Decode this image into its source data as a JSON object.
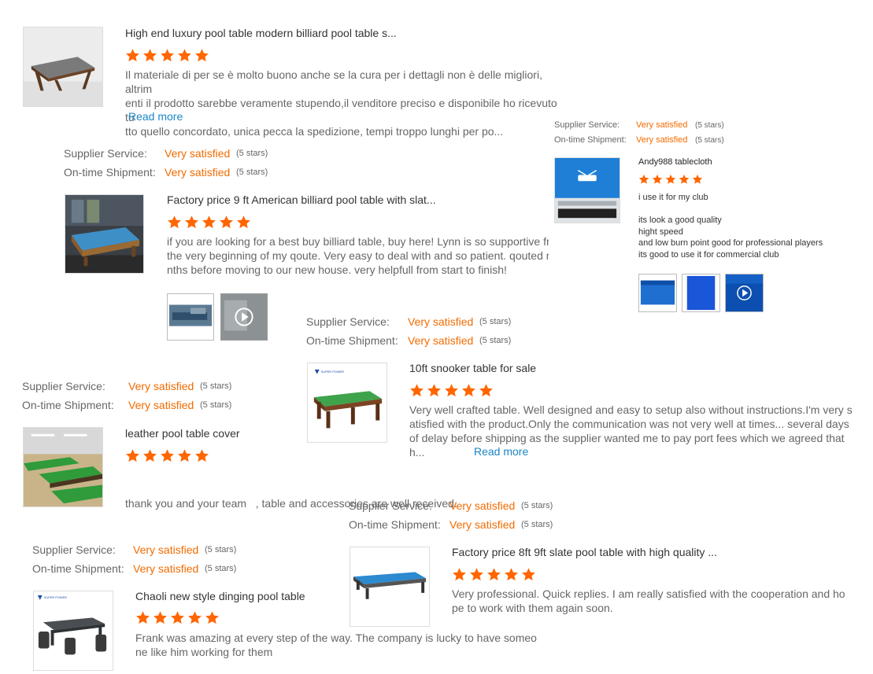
{
  "colors": {
    "star": "#ff6600",
    "satisfied": "#f26b00",
    "link": "#1b86c6"
  },
  "rating_labels": {
    "supplier_service": "Supplier Service:",
    "on_time_shipment": "On-time Shipment:",
    "value": "Very satisfied",
    "stars": "(5 stars)"
  },
  "reviews": [
    {
      "title": "High end luxury pool table modern billiard pool table s...",
      "stars": 5,
      "text_lines": [
        "Il materiale di per se è molto buono anche se la cura per i dettagli non è delle migliori, altrim",
        "enti il prodotto sarebbe veramente stupendo,il venditore preciso e disponibile ho ricevuto tu",
        "tto quello concordato, unica pecca la spedizione, tempi troppo lunghi per po..."
      ],
      "read_more": "Read more"
    },
    {
      "title": "Factory price 9 ft American billiard pool table with slat...",
      "stars": 5,
      "text_lines": [
        "if you are looking for a best buy billiard table, buy here! Lynn is so supportive fro",
        "the very beginning of my qoute. Very easy to deal with and so patient. qouted mo",
        "nths before moving to our new house. very helpfull from start to finish!"
      ]
    },
    {
      "title": "Andy988 tablecloth",
      "stars": 5,
      "text_lines": [
        "i use it for my club",
        "",
        "its look a good quality",
        "hight speed",
        "and low burn point good for professional  players",
        "its good to use it for commercial club"
      ]
    },
    {
      "title": "10ft snooker table for sale",
      "stars": 5,
      "text_lines": [
        "Very well crafted table. Well designed and easy to setup also without instructions.I'm very s",
        "atisfied with the product.Only the communication was not very well at times... several days",
        "of delay before shipping  as the supplier wanted me to pay port fees which we agreed that",
        "h..."
      ],
      "read_more": "Read more",
      "logo_text": "SUPER POWER"
    },
    {
      "title": "leather pool table cover",
      "stars": 5,
      "text_lines": [
        "thank you and your team   , table and accessories are well received."
      ]
    },
    {
      "title": "Factory price 8ft 9ft slate pool table with high quality ...",
      "stars": 5,
      "text_lines": [
        "Very professional. Quick replies. I am really satisfied with the cooperation and ho",
        "pe to work with them again soon."
      ]
    },
    {
      "title": "Chaoli new style dinging pool table",
      "stars": 5,
      "text_lines": [
        "Frank was amazing at every step of the way. The company is lucky to have someo",
        "ne like him working for them"
      ],
      "logo_text": "SUPER POWER"
    }
  ]
}
